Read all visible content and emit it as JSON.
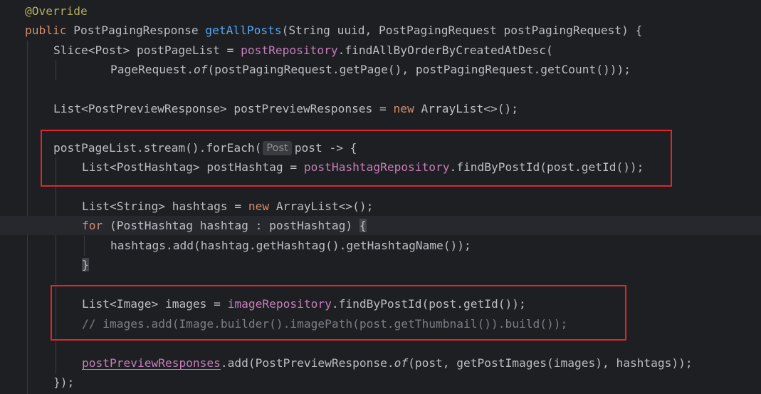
{
  "editor": {
    "colors": {
      "background": "#1e1f22",
      "keyword": "#cf8e6d",
      "annotation": "#b3ae60",
      "method_declaration": "#56a8f5",
      "field": "#c77dbb",
      "comment": "#7a7e85",
      "highlight_box": "#e0252b"
    },
    "lines": {
      "l1": {
        "annotation": "@Override"
      },
      "l2": {
        "kw": "public",
        "type": " PostPagingResponse ",
        "method": "getAllPosts",
        "params": "(String uuid, PostPagingRequest postPagingRequest) {"
      },
      "l3": {
        "decl": "Slice<Post> postPageList = ",
        "field": "postRepository",
        "call": ".findAllByOrderByCreatedAtDesc("
      },
      "l4": {
        "prefix": "PageRequest.",
        "static_call": "of",
        "args": "(postPagingRequest.getPage(), postPagingRequest.getCount()));"
      },
      "l5": {},
      "l6": {
        "decl": "List<PostPreviewResponse> postPreviewResponses = ",
        "kw": "new",
        "rest": " ArrayList<>();"
      },
      "l7": {},
      "l8": {
        "code": "postPageList.stream().forEach(",
        "hint": "Post",
        "rest": "post -> {"
      },
      "l9": {
        "decl": "List<PostHashtag> postHashtag = ",
        "field": "postHashtagRepository",
        "call": ".findByPostId(post.getId());"
      },
      "l10": {},
      "l11": {
        "decl": "List<String> hashtags = ",
        "kw": "new",
        "rest": " ArrayList<>();"
      },
      "l12": {
        "kw": "for",
        "code": " (PostHashtag hashtag : postHashtag) ",
        "brace": "{"
      },
      "l13": {
        "code": "hashtags.add(hashtag.getHashtag().getHashtagName());"
      },
      "l14": {
        "brace": "}"
      },
      "l15": {},
      "l16": {
        "decl": "List<Image> images = ",
        "field": "imageRepository",
        "call": ".findByPostId(post.getId());"
      },
      "l17": {
        "comment": "// images.add(Image.builder().imagePath(post.getThumbnail()).build());"
      },
      "l18": {},
      "l19": {
        "field": "postPreviewResponses",
        "pre": ".add(PostPreviewResponse.",
        "static_call": "of",
        "rest": "(post, getPostImages(images), hashtags));"
      },
      "l20": {
        "code": "});"
      }
    }
  }
}
